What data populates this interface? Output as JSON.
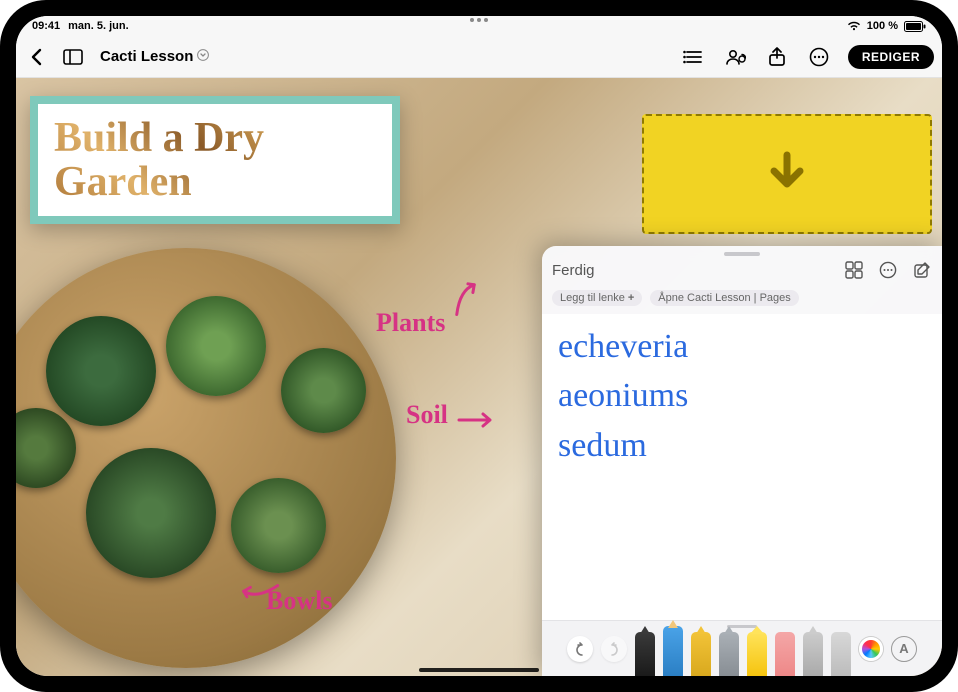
{
  "status": {
    "time": "09:41",
    "date": "man. 5. jun.",
    "battery": "100 %"
  },
  "toolbar": {
    "doc_title": "Cacti Lesson",
    "edit_label": "REDIGER"
  },
  "slide": {
    "heading_line1": "Build a Dry",
    "heading_line2": "Garden",
    "label_plants": "Plants",
    "label_soil": "Soil",
    "label_bowls": "Bowls"
  },
  "note": {
    "done_label": "Ferdig",
    "add_link_label": "Legg til lenke",
    "open_label": "Åpne Cacti Lesson | Pages",
    "lines": [
      "echeveria",
      "aeoniums",
      "sedum"
    ]
  }
}
